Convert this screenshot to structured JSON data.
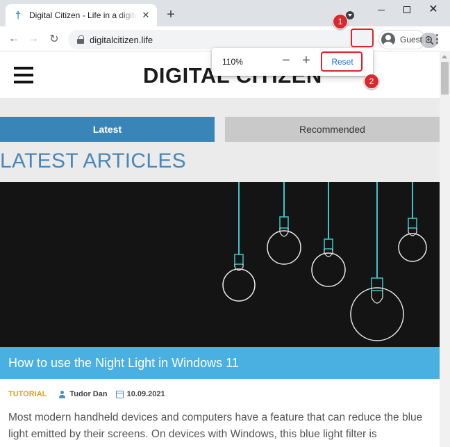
{
  "browser": {
    "tab_title": "Digital Citizen - Life in a digital world",
    "tab_close_glyph": "✕",
    "new_tab_glyph": "+",
    "url": "digitalcitizen.life",
    "profile_label": "Guest",
    "back_glyph": "←",
    "forward_glyph": "→",
    "reload_glyph": "↻",
    "close_glyph": "✕"
  },
  "zoom_bubble": {
    "level": "110%",
    "minus_glyph": "−",
    "plus_glyph": "+",
    "reset_label": "Reset"
  },
  "annotations": {
    "badge_1": "1",
    "badge_2": "2",
    "color": "#e0232a"
  },
  "site": {
    "logo": "DIGITAL CITIZEN",
    "tabs": [
      {
        "label": "Latest",
        "active": true
      },
      {
        "label": "Recommended",
        "active": false
      }
    ],
    "section_title": "LATEST ARTICLES",
    "article": {
      "title": "How to use the Night Light in Windows 11",
      "category": "TUTORIAL",
      "author": "Tudor Dan",
      "date": "10.09.2021",
      "excerpt": "Most modern handheld devices and computers have a feature that can reduce the blue light emitted by their screens. On devices with Windows, this blue light filter is"
    }
  },
  "colors": {
    "accent_tab": "#3a85b8",
    "title_bar": "#4ab0e2",
    "section_title": "#4a87b8",
    "category": "#e0a023",
    "bulb_cord": "#3ec7c7"
  }
}
